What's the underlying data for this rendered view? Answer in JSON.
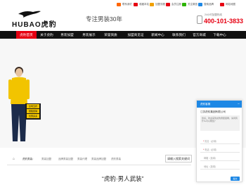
{
  "topbar": {
    "items": [
      {
        "label": "联系我们"
      },
      {
        "label": "收藏本站"
      },
      {
        "label": "加盟流程"
      },
      {
        "label": "会员注册"
      },
      {
        "label": "关注微信"
      },
      {
        "label": "搜索品牌"
      },
      {
        "label": "网站地图"
      }
    ]
  },
  "header": {
    "logo_text": "HUBAO虎豹",
    "slogan": "专注男装30年",
    "phone_caption": "24小时加盟热线",
    "phone_number": "400-101-3833"
  },
  "nav": {
    "items": [
      {
        "label": "虎豹首页"
      },
      {
        "label": "关于虎豹"
      },
      {
        "label": "男装加盟"
      },
      {
        "label": "男装展示"
      },
      {
        "label": "荣誉资质"
      },
      {
        "label": "加盟商见证"
      },
      {
        "label": "新闻中心"
      },
      {
        "label": "联系我们"
      },
      {
        "label": "官方商城"
      },
      {
        "label": "下载中心"
      }
    ]
  },
  "banner": {
    "promo_lines": [
      "全场五折",
      "量贩促销",
      "优惠多多"
    ]
  },
  "breadcrumb": {
    "label": "虎豹男装：",
    "items": [
      "男装加盟",
      "品牌男装加盟",
      "男装代理",
      "男装品牌加盟",
      "虎豹男装"
    ]
  },
  "search_button": "请输入搜索关键词",
  "headline": "“虎豹·男人武装”",
  "chat": {
    "title": "虎豹客服",
    "close": "−",
    "company": "江苏虎豹集团有限公司",
    "bubble": "您好，欢迎来到虎豹男装官网，请问有什么可以帮您？",
    "fields": [
      {
        "required": "*",
        "placeholder": "姓名（必填）"
      },
      {
        "required": "*",
        "placeholder": "电话（必填）"
      },
      {
        "required": "",
        "placeholder": "邮箱（选填）"
      },
      {
        "required": "",
        "placeholder": "地址（选填）"
      }
    ],
    "send_label": "提交"
  },
  "colors": {
    "brand_red": "#e60012",
    "nav_black": "#111111",
    "chat_blue": "#1e88e5"
  }
}
